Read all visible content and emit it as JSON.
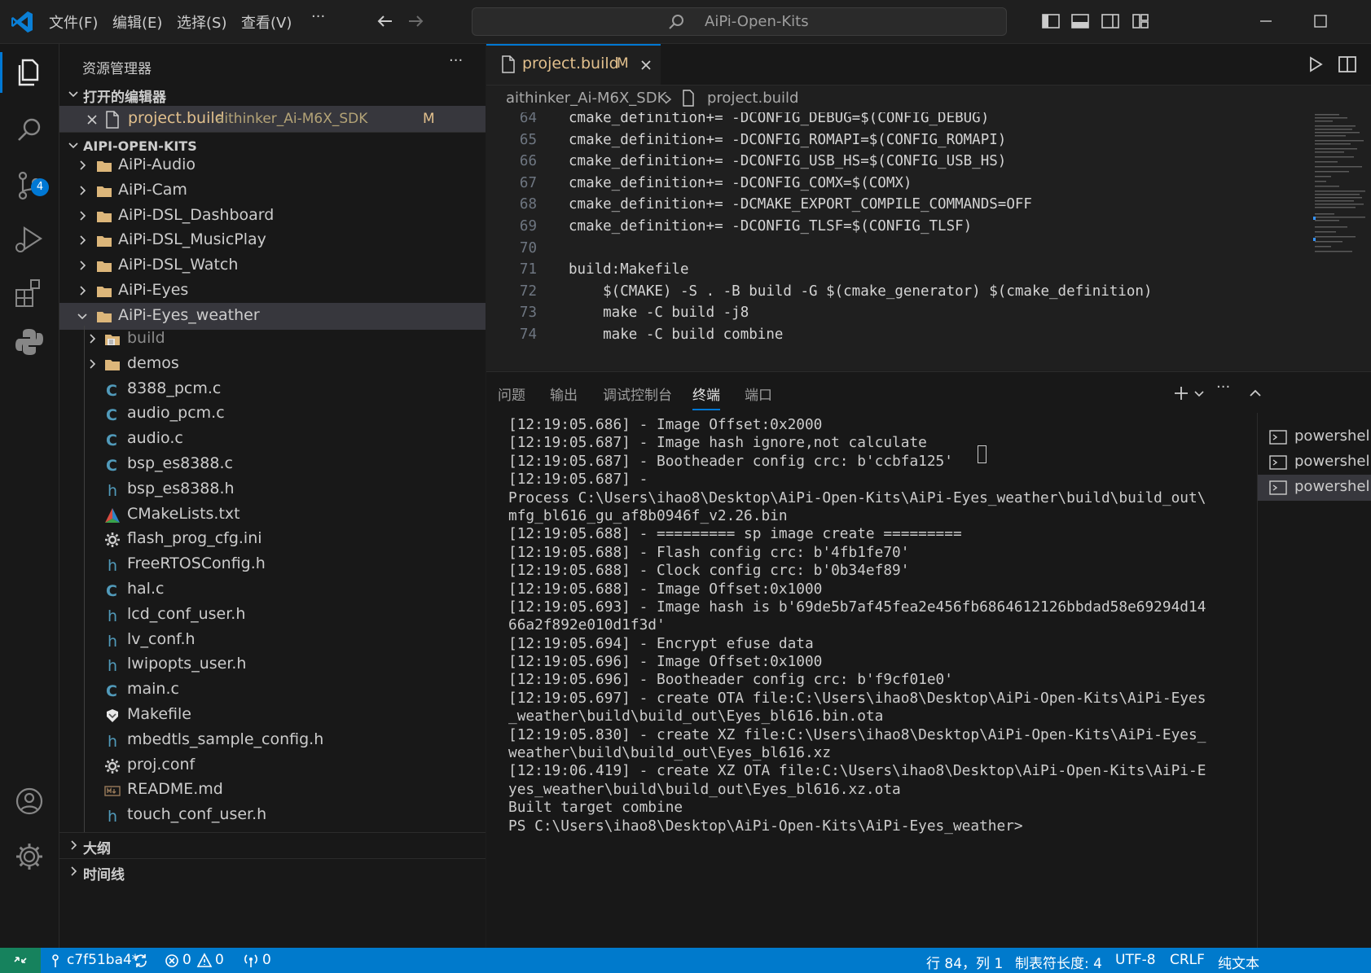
{
  "titlebar": {
    "menus": [
      "文件(F)",
      "编辑(E)",
      "选择(S)",
      "查看(V)"
    ],
    "more": "···",
    "search_text": "AiPi-Open-Kits"
  },
  "activity": {
    "scm_badge": "4"
  },
  "sidebar": {
    "header": "资源管理器",
    "more": "···",
    "open_editors_title": "打开的编辑器",
    "open_editor": {
      "name": "project.build",
      "path": "aithinker_Ai-M6X_SDK",
      "status": "M"
    },
    "root_title": "AIPI-OPEN-KITS",
    "folders": [
      "AiPi-Audio",
      "AiPi-Cam",
      "AiPi-DSL_Dashboard",
      "AiPi-DSL_MusicPlay",
      "AiPi-DSL_Watch",
      "AiPi-Eyes",
      "AiPi-Eyes_weather"
    ],
    "children": [
      {
        "name": "build",
        "kind": "folder-build"
      },
      {
        "name": "demos",
        "kind": "folder"
      },
      {
        "name": "8388_pcm.c",
        "kind": "c"
      },
      {
        "name": "audio_pcm.c",
        "kind": "c"
      },
      {
        "name": "audio.c",
        "kind": "c"
      },
      {
        "name": "bsp_es8388.c",
        "kind": "c"
      },
      {
        "name": "bsp_es8388.h",
        "kind": "h"
      },
      {
        "name": "CMakeLists.txt",
        "kind": "cmake"
      },
      {
        "name": "flash_prog_cfg.ini",
        "kind": "gear"
      },
      {
        "name": "FreeRTOSConfig.h",
        "kind": "h"
      },
      {
        "name": "hal.c",
        "kind": "c"
      },
      {
        "name": "lcd_conf_user.h",
        "kind": "h"
      },
      {
        "name": "lv_conf.h",
        "kind": "h"
      },
      {
        "name": "lwipopts_user.h",
        "kind": "h"
      },
      {
        "name": "main.c",
        "kind": "c"
      },
      {
        "name": "Makefile",
        "kind": "make"
      },
      {
        "name": "mbedtls_sample_config.h",
        "kind": "h"
      },
      {
        "name": "proj.conf",
        "kind": "gear"
      },
      {
        "name": "README.md",
        "kind": "md"
      },
      {
        "name": "touch_conf_user.h",
        "kind": "h"
      }
    ],
    "outline_title": "大纲",
    "timeline_title": "时间线"
  },
  "editor": {
    "tab": {
      "name": "project.build",
      "status": "M"
    },
    "breadcrumb": {
      "folder": "aithinker_Ai-M6X_SDK",
      "file": "project.build"
    },
    "lines": [
      {
        "n": "64",
        "text": "cmake_definition+= -DCONFIG_DEBUG=$(CONFIG_DEBUG)"
      },
      {
        "n": "65",
        "text": "cmake_definition+= -DCONFIG_ROMAPI=$(CONFIG_ROMAPI)"
      },
      {
        "n": "66",
        "text": "cmake_definition+= -DCONFIG_USB_HS=$(CONFIG_USB_HS)"
      },
      {
        "n": "67",
        "text": "cmake_definition+= -DCONFIG_COMX=$(COMX)"
      },
      {
        "n": "68",
        "text": "cmake_definition+= -DCMAKE_EXPORT_COMPILE_COMMANDS=OFF"
      },
      {
        "n": "69",
        "text": "cmake_definition+= -DCONFIG_TLSF=$(CONFIG_TLSF)"
      },
      {
        "n": "70",
        "text": ""
      },
      {
        "n": "71",
        "text": "build:Makefile"
      },
      {
        "n": "72",
        "text": "    $(CMAKE) -S . -B build -G $(cmake_generator) $(cmake_definition)"
      },
      {
        "n": "73",
        "text": "    make -C build -j8"
      },
      {
        "n": "74",
        "text": "    make -C build combine"
      }
    ]
  },
  "panel": {
    "tabs": [
      "问题",
      "输出",
      "调试控制台",
      "终端",
      "端口"
    ],
    "active_tab": "终端",
    "terminal_lines": [
      "[12:19:05.686] - Image Offset:0x2000",
      "[12:19:05.687] - Image hash ignore,not calculate",
      "[12:19:05.687] - Bootheader config crc: b'ccbfa125'",
      "[12:19:05.687] -",
      "Process C:\\Users\\ihao8\\Desktop\\AiPi-Open-Kits\\AiPi-Eyes_weather\\build\\build_out\\",
      "mfg_bl616_gu_af8b0946f_v2.26.bin",
      "[12:19:05.688] - ========= sp image create =========",
      "[12:19:05.688] - Flash config crc: b'4fb1fe70'",
      "[12:19:05.688] - Clock config crc: b'0b34ef89'",
      "[12:19:05.688] - Image Offset:0x1000",
      "[12:19:05.693] - Image hash is b'69de5b7af45fea2e456fb6864612126bbdad58e69294d14",
      "66a2f892e010d1f3d'",
      "[12:19:05.694] - Encrypt efuse data",
      "[12:19:05.696] - Image Offset:0x1000",
      "[12:19:05.696] - Bootheader config crc: b'f9cf01e0'",
      "[12:19:05.697] - create OTA file:C:\\Users\\ihao8\\Desktop\\AiPi-Open-Kits\\AiPi-Eyes",
      "_weather\\build\\build_out\\Eyes_bl616.bin.ota",
      "[12:19:05.830] - create XZ file:C:\\Users\\ihao8\\Desktop\\AiPi-Open-Kits\\AiPi-Eyes_",
      "weather\\build\\build_out\\Eyes_bl616.xz",
      "[12:19:06.419] - create XZ OTA file:C:\\Users\\ihao8\\Desktop\\AiPi-Open-Kits\\AiPi-E",
      "yes_weather\\build\\build_out\\Eyes_bl616.xz.ota",
      "Built target combine",
      "PS C:\\Users\\ihao8\\Desktop\\AiPi-Open-Kits\\AiPi-Eyes_weather>"
    ],
    "terminals": [
      "powershell",
      "powershell",
      "powershell"
    ]
  },
  "statusbar": {
    "branch": "c7f51ba4*",
    "errors": "0",
    "warnings": "0",
    "ports": "0",
    "position": "行 84，列 1",
    "tab_size": "制表符长度: 4",
    "encoding": "UTF-8",
    "eol": "CRLF",
    "language": "纯文本"
  },
  "colors": {
    "accent": "#0078d4",
    "status_bg": "#007acc",
    "modified": "#e2c08d",
    "folder": "#dcb67a"
  }
}
